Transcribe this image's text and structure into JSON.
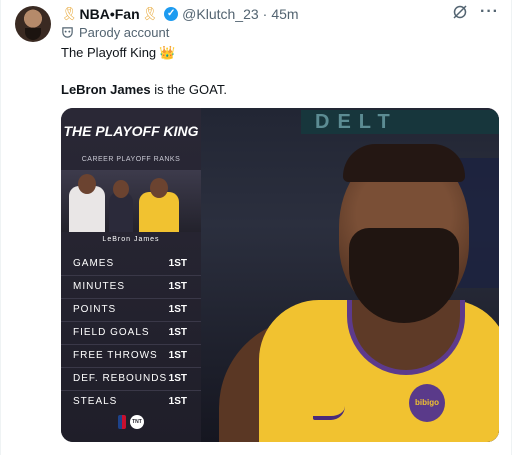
{
  "tweet": {
    "display_name": "NBA•Fan",
    "handle": "@Klutch_23",
    "separator": "·",
    "time": "45m",
    "label": "Parody account",
    "text_line1": "The Playoff King",
    "text_line2_bold": "LeBron James",
    "text_line2_rest": " is the GOAT."
  },
  "icons": {
    "ribbon": "ribbon-icon",
    "verified": "verified-badge-icon",
    "grok": "grok-icon",
    "more": "more-icon",
    "parody": "parody-mask-icon",
    "crown": "crown-emoji"
  },
  "graphic": {
    "title": "THE PLAYOFF KING",
    "subtitle": "CAREER PLAYOFF RANKS",
    "player": "LeBron James",
    "rows": [
      {
        "stat": "GAMES",
        "rank": "1ST"
      },
      {
        "stat": "MINUTES",
        "rank": "1ST"
      },
      {
        "stat": "POINTS",
        "rank": "1ST"
      },
      {
        "stat": "FIELD GOALS",
        "rank": "1ST"
      },
      {
        "stat": "FREE THROWS",
        "rank": "1ST"
      },
      {
        "stat": "DEF. REBOUNDS",
        "rank": "1ST"
      },
      {
        "stat": "STEALS",
        "rank": "1ST"
      }
    ],
    "arena_sign": "DELT",
    "jersey_patch": "bibigo"
  },
  "colors": {
    "verified_blue": "#1d9bf0",
    "lakers_gold": "#f1c230",
    "lakers_purple": "#5d3a8c",
    "panel_bg": "#1f1e29"
  }
}
